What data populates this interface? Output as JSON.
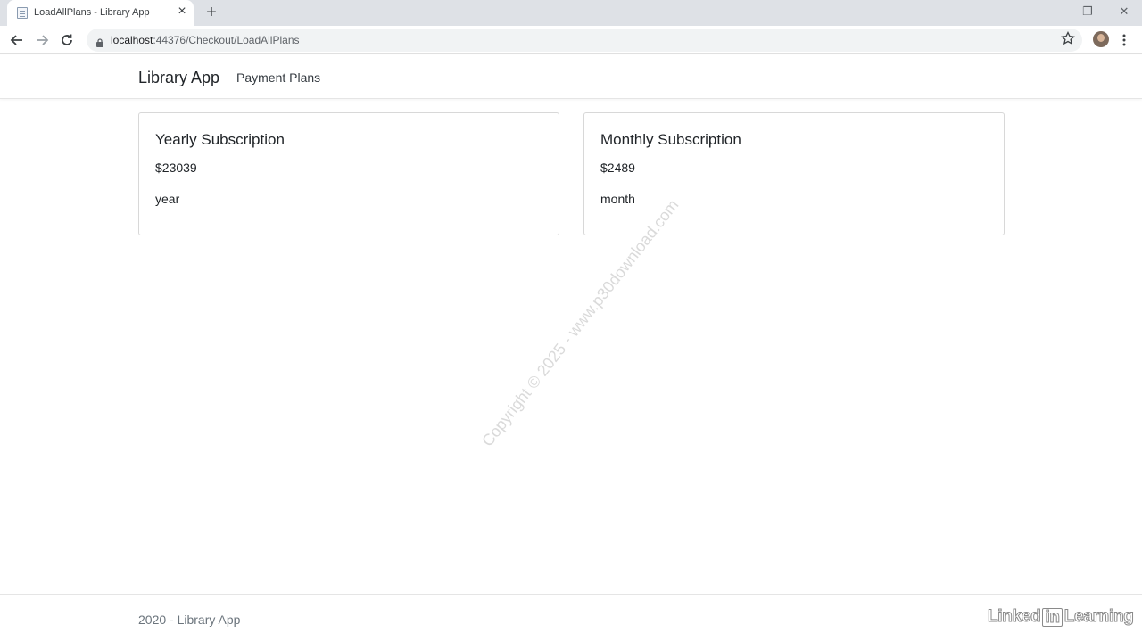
{
  "browser": {
    "tab_title": "LoadAllPlans - Library App",
    "url_host": "localhost",
    "url_path": ":44376/Checkout/LoadAllPlans"
  },
  "navbar": {
    "brand": "Library App",
    "links": [
      "Payment Plans"
    ]
  },
  "plans": [
    {
      "title": "Yearly Subscription",
      "price": "$23039",
      "interval": "year"
    },
    {
      "title": "Monthly Subscription",
      "price": "$2489",
      "interval": "month"
    }
  ],
  "watermark": "Copyright © 2025 - www.p30download.com",
  "footer": {
    "text": "2020 - Library App",
    "logo": "LinkedIn Learning"
  },
  "colors": {
    "tabstrip": "#dee1e6",
    "text": "#212529",
    "muted": "#6c757d"
  }
}
